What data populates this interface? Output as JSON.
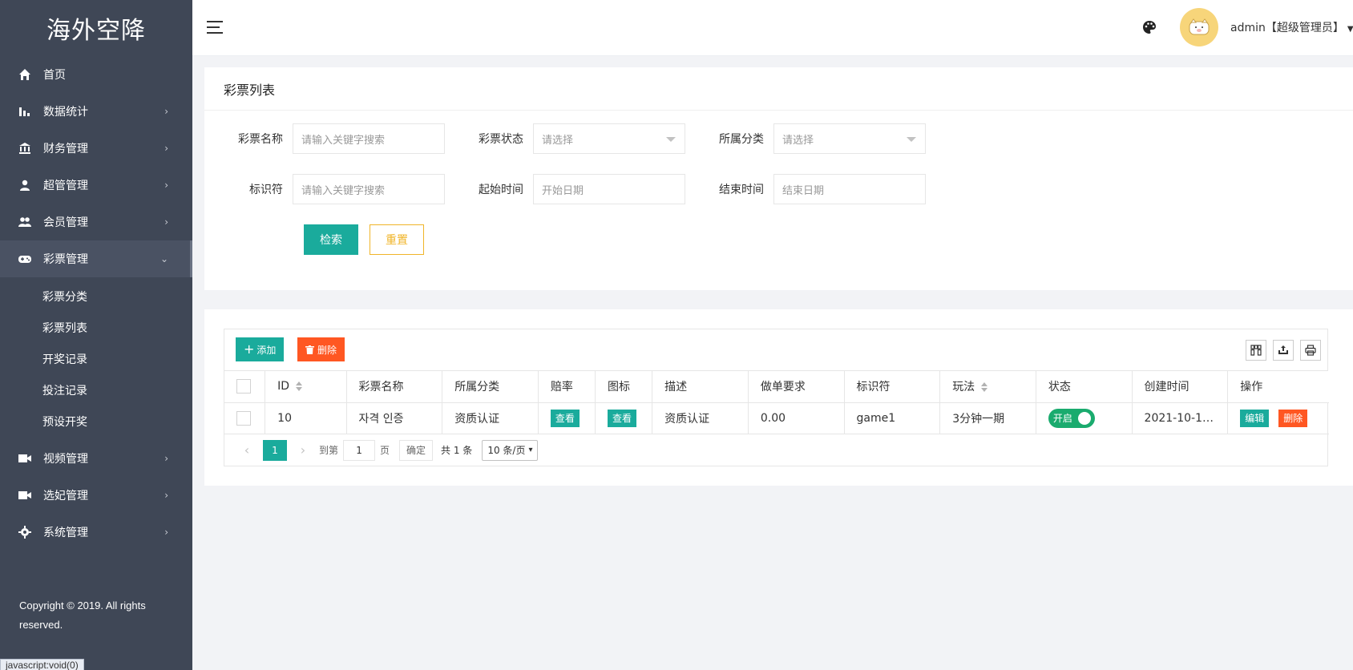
{
  "sidebar": {
    "brand": "海外空降",
    "items": [
      {
        "label": "首页",
        "icon": "home-icon",
        "arrow": ""
      },
      {
        "label": "数据统计",
        "icon": "bar-chart-icon",
        "arrow": "›"
      },
      {
        "label": "财务管理",
        "icon": "bank-icon",
        "arrow": "›"
      },
      {
        "label": "超管管理",
        "icon": "user-icon",
        "arrow": "›"
      },
      {
        "label": "会员管理",
        "icon": "users-icon",
        "arrow": "›"
      },
      {
        "label": "彩票管理",
        "icon": "gamepad-icon",
        "arrow": "›"
      }
    ],
    "submenu": [
      "彩票分类",
      "彩票列表",
      "开奖记录",
      "投注记录",
      "预设开奖"
    ],
    "items_after": [
      {
        "label": "视频管理",
        "icon": "video-icon",
        "arrow": "›"
      },
      {
        "label": "选妃管理",
        "icon": "video-icon",
        "arrow": "›"
      }
    ],
    "system": {
      "label": "系统管理",
      "icon": "gear-icon",
      "arrow": "›"
    },
    "copyright": "Copyright © 2019. All rights reserved.",
    "status_url": "javascript:void(0)"
  },
  "header": {
    "user": "admin【超级管理员】"
  },
  "search": {
    "title": "彩票列表",
    "fields": {
      "name_label": "彩票名称",
      "name_placeholder": "请输入关键字搜索",
      "status_label": "彩票状态",
      "status_placeholder": "请选择",
      "category_label": "所属分类",
      "category_placeholder": "请选择",
      "key_label": "标识符",
      "key_placeholder": "请输入关键字搜索",
      "start_label": "起始时间",
      "start_placeholder": "开始日期",
      "end_label": "结束时间",
      "end_placeholder": "结束日期"
    },
    "search_btn": "检索",
    "reset_btn": "重置"
  },
  "table": {
    "add_btn": "添加",
    "delete_btn": "删除",
    "columns": [
      "ID",
      "彩票名称",
      "所属分类",
      "赔率",
      "图标",
      "描述",
      "做单要求",
      "标识符",
      "玩法",
      "状态",
      "创建时间",
      "操作"
    ],
    "rows": [
      {
        "id": "10",
        "name": "자격 인증",
        "category": "资质认证",
        "odds_btn": "查看",
        "icon_btn": "查看",
        "desc": "资质认证",
        "requirement": "0.00",
        "key": "game1",
        "play": "3分钟一期",
        "status": "开启",
        "created": "2021-10-17...",
        "edit_btn": "编辑",
        "del_btn": "删除"
      }
    ],
    "pager": {
      "current": "1",
      "goto_label": "到第",
      "goto_value": "1",
      "page_unit": "页",
      "confirm": "确定",
      "total": "共 1 条",
      "page_size": "10 条/页"
    }
  },
  "colors": {
    "sidebar_bg": "#3f4756",
    "primary": "#1aab9c",
    "danger": "#ff5722",
    "warn": "#f0b529",
    "switch_on": "#1aab6e"
  }
}
